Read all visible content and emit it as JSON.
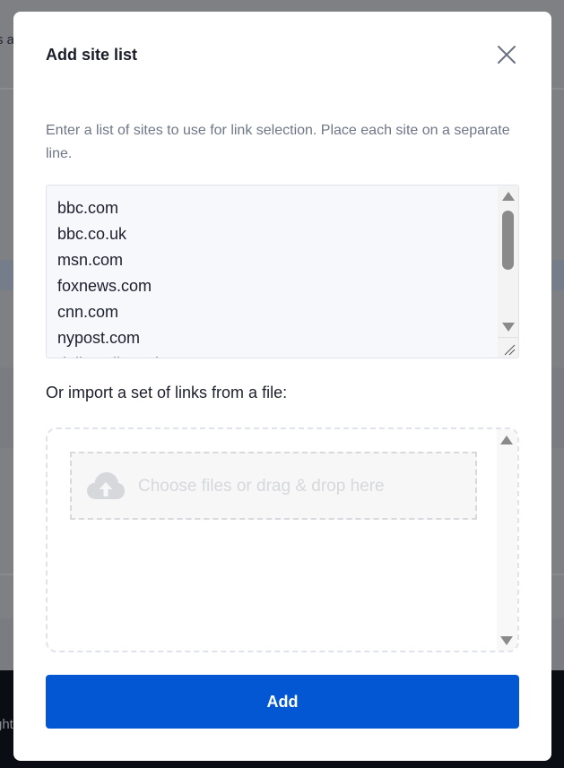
{
  "background": {
    "partial_text_top": "s a",
    "partial_text_footer": "ght"
  },
  "modal": {
    "title": "Add site list",
    "close_icon": "close-icon",
    "description": "Enter a list of sites to use for link selection. Place each site on a separate line.",
    "site_list": {
      "lines": [
        "bbc.com",
        "bbc.co.uk",
        "msn.com",
        "foxnews.com",
        "cnn.com",
        "nypost.com",
        "dailymail.co.uk"
      ]
    },
    "import_label": "Or import a set of links from a file:",
    "dropzone": {
      "icon": "cloud-upload-icon",
      "text": "Choose files or drag & drop here"
    },
    "add_label": "Add",
    "colors": {
      "accent": "#0457d3",
      "overlay": "#7f8084"
    }
  }
}
